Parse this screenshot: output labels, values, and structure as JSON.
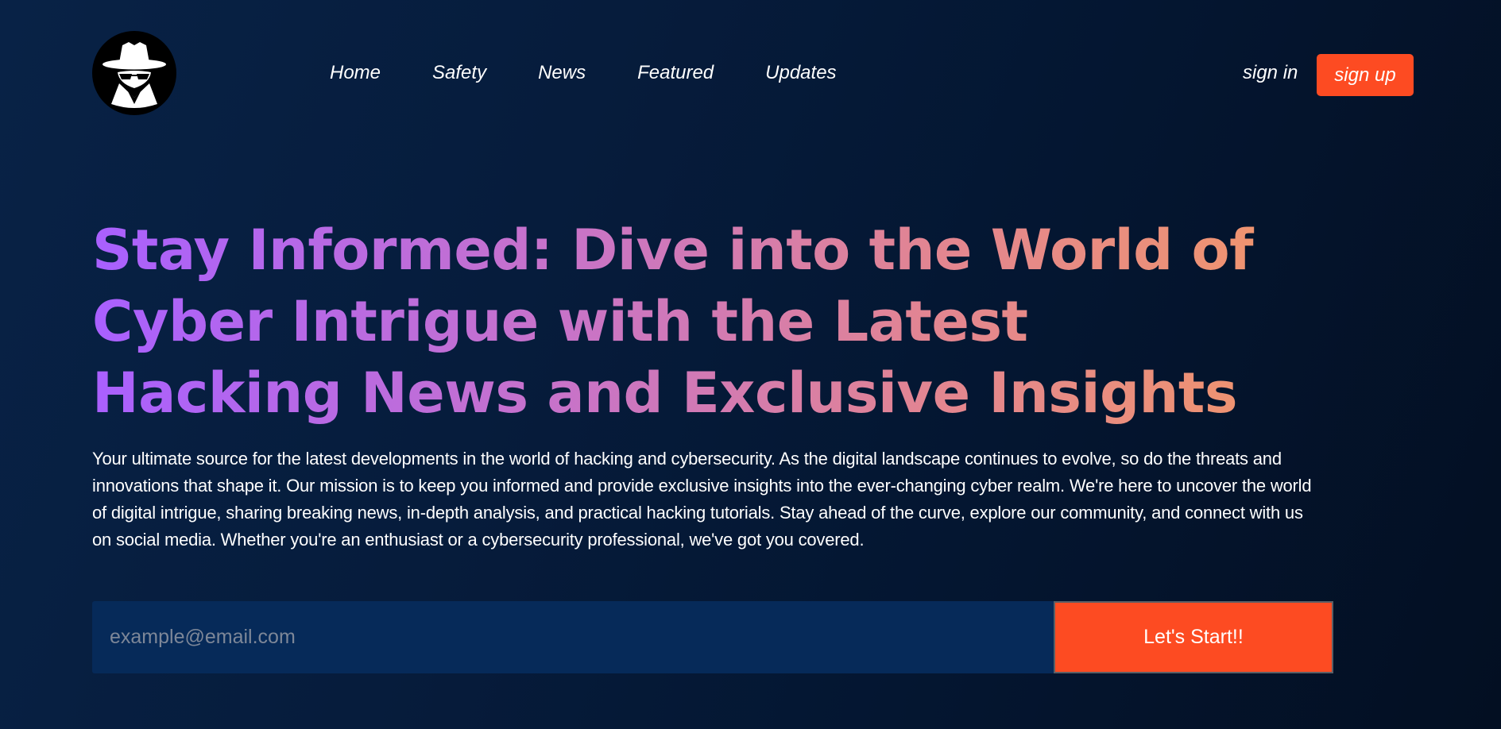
{
  "brand": {
    "logo_icon": "hacker-spy-icon"
  },
  "nav": {
    "links": [
      "Home",
      "Safety",
      "News",
      "Featured",
      "Updates"
    ],
    "sign_in": "sign in",
    "sign_up": "sign up"
  },
  "hero": {
    "headline": "Stay Informed: Dive into the World of Cyber Intrigue with the Latest Hacking News and Exclusive Insights",
    "description": "Your ultimate source for the latest developments in the world of hacking and cybersecurity. As the digital landscape continues to evolve, so do the threats and innovations that shape it. Our mission is to keep you informed and provide exclusive insights into the ever-changing cyber realm. We're here to uncover the world of digital intrigue, sharing breaking news, in-depth analysis, and practical hacking tutorials. Stay ahead of the curve, explore our community, and connect with us on social media. Whether you're an enthusiast or a cybersecurity professional, we've got you covered."
  },
  "signup_form": {
    "email_placeholder": "example@email.com",
    "email_value": "",
    "button_label": "Let's Start!!"
  },
  "colors": {
    "background": "#061c3c",
    "accent": "#fd4b22",
    "input_background": "#062a59",
    "headline_gradient_start": "#a960ff",
    "headline_gradient_end": "#f0956d"
  }
}
